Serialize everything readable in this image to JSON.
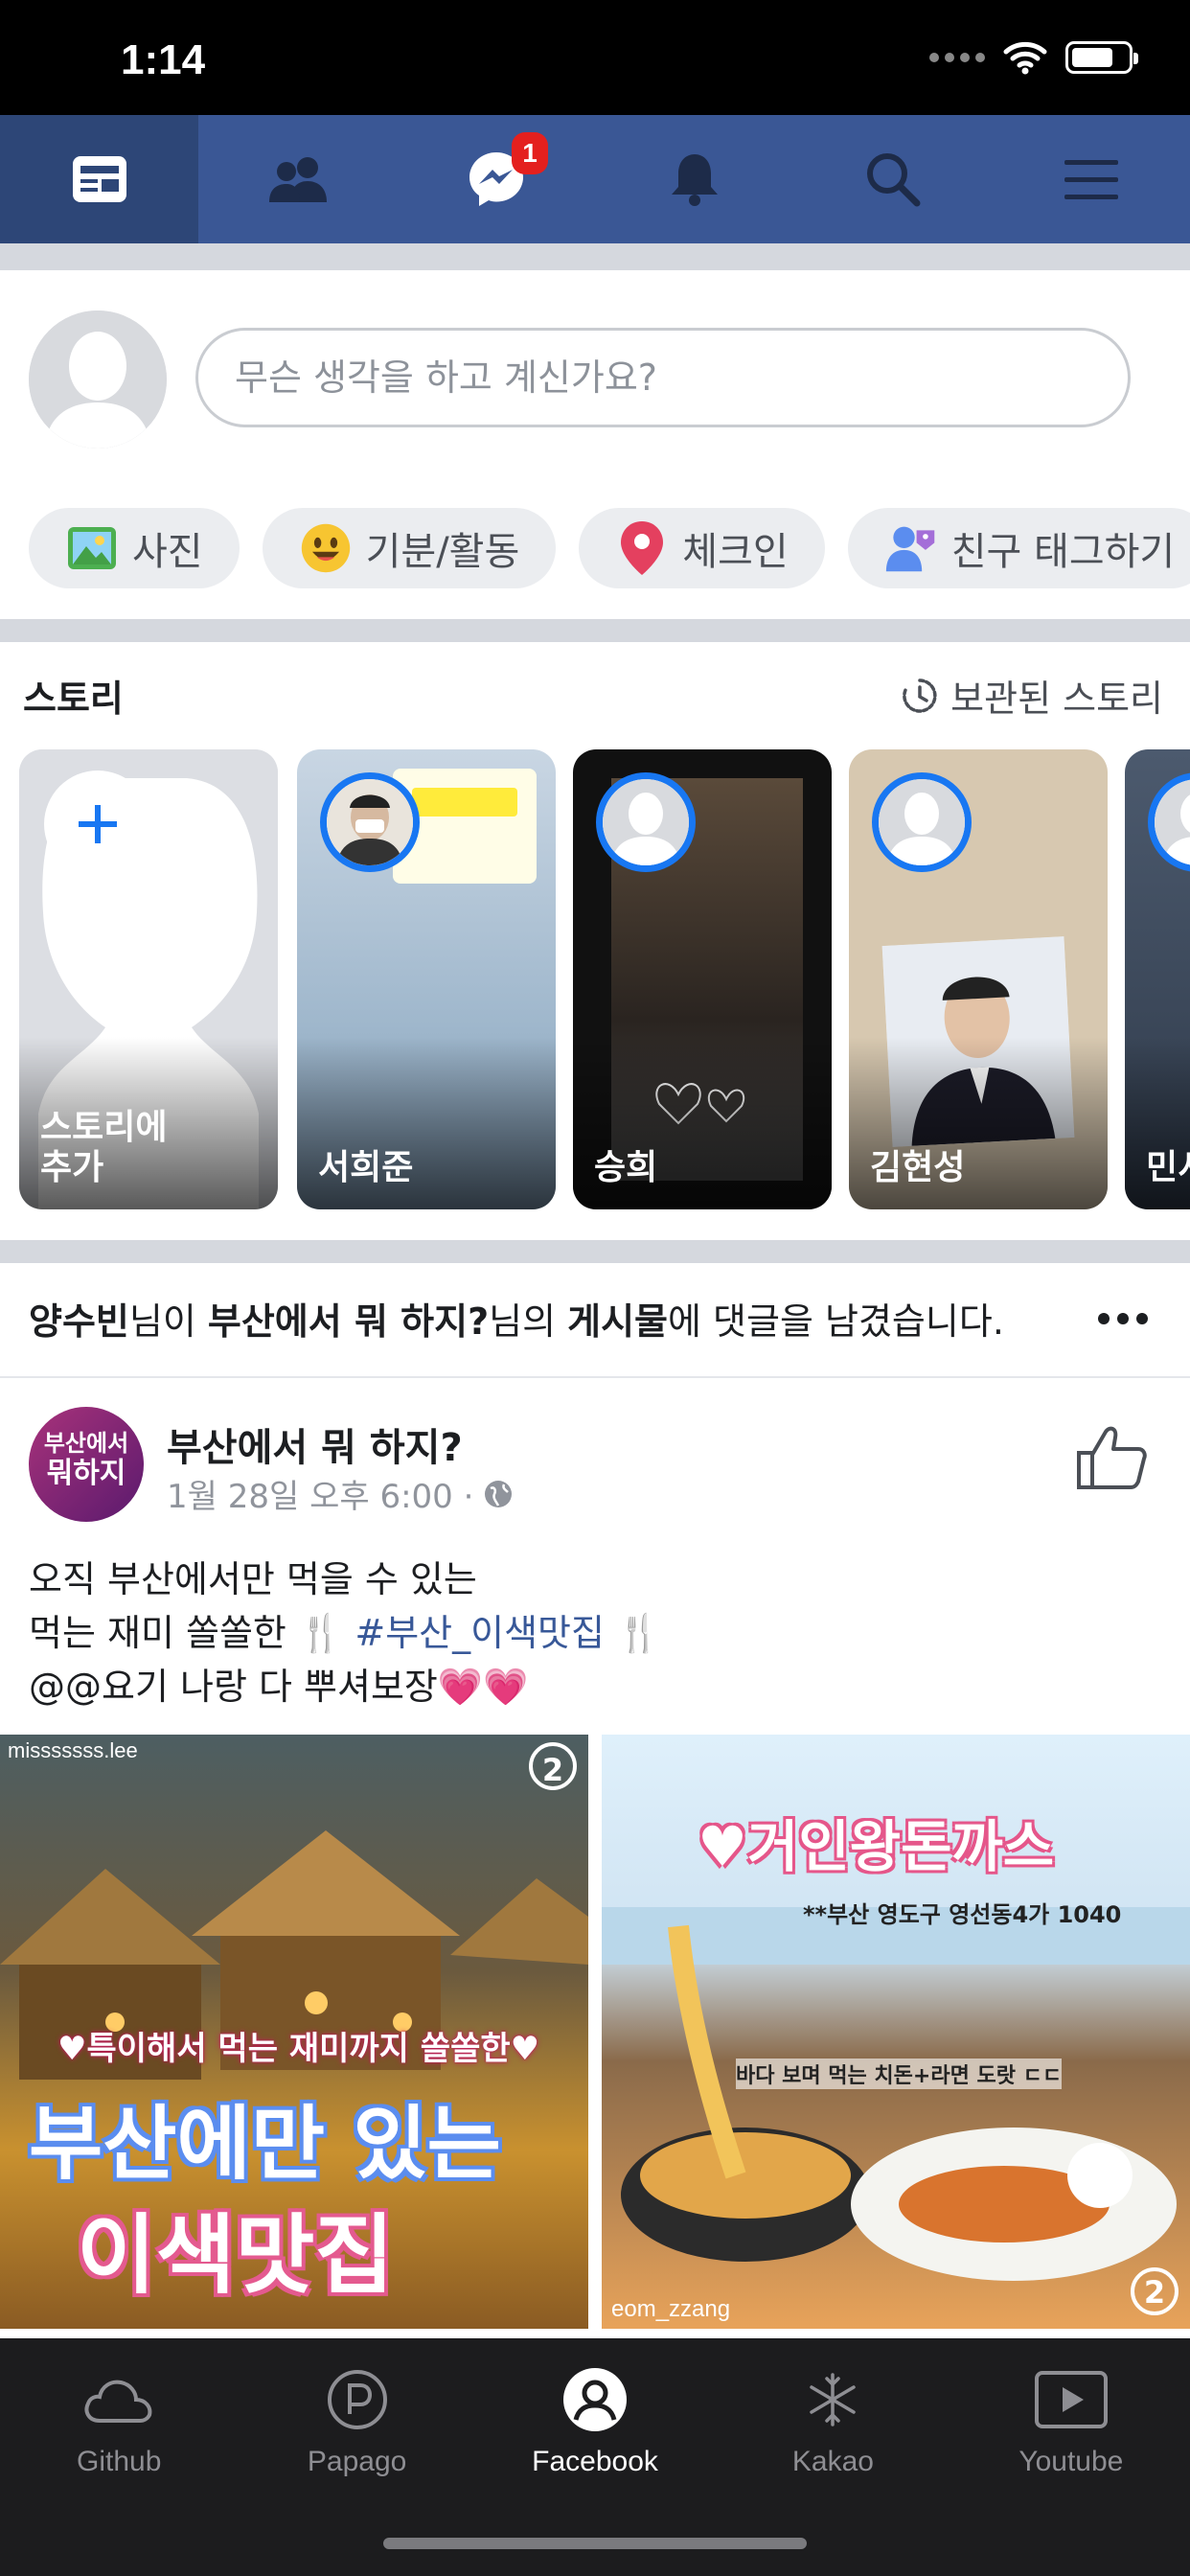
{
  "status_bar": {
    "time": "1:14"
  },
  "fb_nav": {
    "items": [
      "news-feed",
      "friends",
      "messenger",
      "notifications",
      "search",
      "menu"
    ],
    "messenger_badge": "1",
    "brand_color": "#3a5795"
  },
  "composer": {
    "placeholder": "무슨 생각을 하고 계신가요?",
    "chips": [
      {
        "label": "사진",
        "icon": "photo-icon"
      },
      {
        "label": "기분/활동",
        "icon": "smiley-icon"
      },
      {
        "label": "체크인",
        "icon": "location-pin-icon"
      },
      {
        "label": "친구 태그하기",
        "icon": "tag-friend-icon"
      }
    ]
  },
  "stories": {
    "title": "스토리",
    "archived_label": "보관된 스토리",
    "create_label_line1": "스토리에",
    "create_label_line2": "추가",
    "items": [
      {
        "name": "서희준"
      },
      {
        "name": "승희"
      },
      {
        "name": "김현성"
      },
      {
        "name": "민서"
      }
    ]
  },
  "notification": {
    "user": "양수빈",
    "part1": "님이 ",
    "page": "부산에서 뭐 하지?",
    "part2": "님의 ",
    "target": "게시물",
    "part3": "에 댓글을 남겼습니다."
  },
  "post": {
    "page_name": "부산에서 뭐 하지?",
    "avatar_line1": "부산에서",
    "avatar_line2": "뭐하지",
    "timestamp": "1월 28일 오후 6:00 ·",
    "line1": "오직 부산에서만 먹을 수 있는",
    "line2_pre": "먹는 재미 쏠쏠한 🍴 ",
    "hashtag": "#부산_이색맛집",
    "line2_post": " 🍴",
    "line3": "@@요기 나랑 다 뿌셔보장💗💗",
    "photos": [
      {
        "credit": "misssssss.lee",
        "badge": "2",
        "caption_small": "♥특이해서 먹는 재미까지 쏠쏠한♥",
        "caption_line1": "부산에만 있는",
        "caption_line2": "이색맛집"
      },
      {
        "credit": "eom_zzang",
        "badge": "2",
        "caption_title": "♥거인왕돈까스",
        "caption_address": "**부산 영도구 영선동4가 1040",
        "caption_small": "바다 보며 먹는 치돈+라면 도랏 ㄷㄷ"
      }
    ]
  },
  "tabbar": {
    "tabs": [
      {
        "label": "Github",
        "icon": "cloud-icon"
      },
      {
        "label": "Papago",
        "icon": "papago-p-icon"
      },
      {
        "label": "Facebook",
        "icon": "profile-icon"
      },
      {
        "label": "Kakao",
        "icon": "snowflake-icon"
      },
      {
        "label": "Youtube",
        "icon": "play-video-icon"
      }
    ],
    "active": "Facebook"
  }
}
